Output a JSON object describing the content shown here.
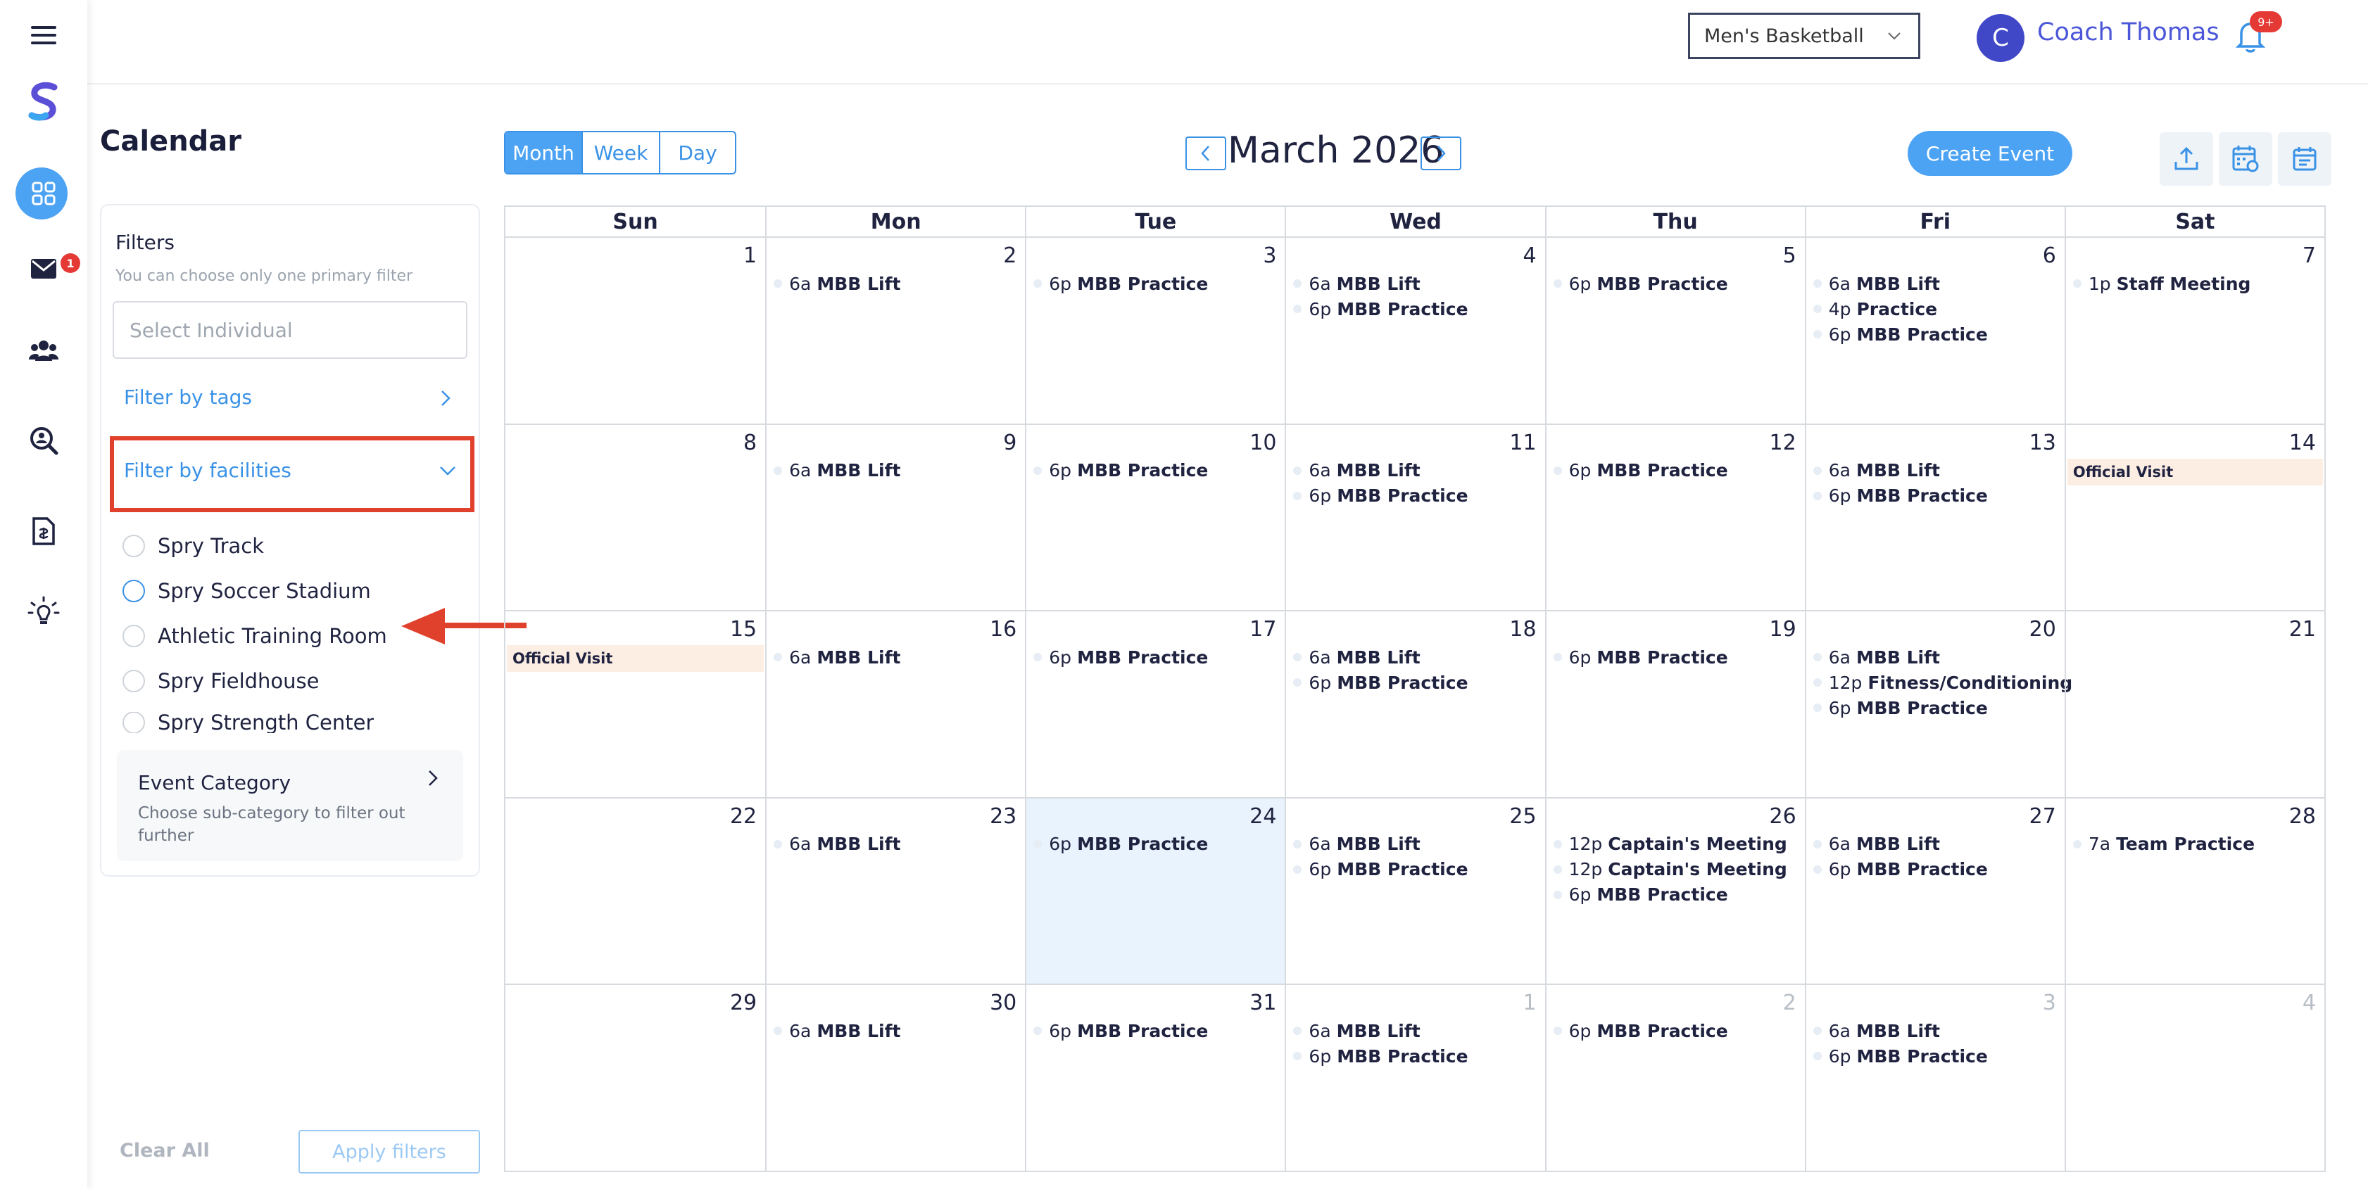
{
  "page_title": "Calendar",
  "header": {
    "team_select": "Men's Basketball",
    "avatar_initial": "C",
    "user_name": "Coach Thomas",
    "notifications_badge": "9+"
  },
  "rail": {
    "mail_badge": "1",
    "icons": [
      "menu-icon",
      "logo-icon",
      "dashboard-icon",
      "mail-icon",
      "team-icon",
      "search-analytics-icon",
      "document-icon",
      "lightbulb-icon"
    ]
  },
  "filters": {
    "title": "Filters",
    "hint": "You can choose only one primary filter",
    "select_placeholder": "Select Individual",
    "by_tags": "Filter by tags",
    "by_facilities": "Filter by facilities",
    "facilities": [
      {
        "label": "Spry Track",
        "selected": false
      },
      {
        "label": "Spry Soccer Stadium",
        "selected": true
      },
      {
        "label": "Athletic Training Room",
        "selected": false
      },
      {
        "label": "Spry Fieldhouse",
        "selected": false
      },
      {
        "label": "Spry Strength Center",
        "selected": false
      }
    ],
    "category_title": "Event Category",
    "category_desc": "Choose sub-category to filter out further",
    "clear_all": "Clear All",
    "apply": "Apply filters"
  },
  "calendar": {
    "views": [
      "Month",
      "Week",
      "Day"
    ],
    "active_view": "Month",
    "month_label": "March 2026",
    "create_event": "Create Event",
    "weekdays": [
      "Sun",
      "Mon",
      "Tue",
      "Wed",
      "Thu",
      "Fri",
      "Sat"
    ],
    "today_index": 23,
    "days": [
      {
        "d": "1",
        "events": []
      },
      {
        "d": "2",
        "events": [
          {
            "t": "6a",
            "n": "MBB Lift"
          }
        ]
      },
      {
        "d": "3",
        "events": [
          {
            "t": "6p",
            "n": "MBB Practice"
          }
        ]
      },
      {
        "d": "4",
        "events": [
          {
            "t": "6a",
            "n": "MBB Lift"
          },
          {
            "t": "6p",
            "n": "MBB Practice"
          }
        ]
      },
      {
        "d": "5",
        "events": [
          {
            "t": "6p",
            "n": "MBB Practice"
          }
        ]
      },
      {
        "d": "6",
        "events": [
          {
            "t": "6a",
            "n": "MBB Lift"
          },
          {
            "t": "4p",
            "n": "Practice"
          },
          {
            "t": "6p",
            "n": "MBB Practice"
          }
        ]
      },
      {
        "d": "7",
        "events": [
          {
            "t": "1p",
            "n": "Staff Meeting"
          }
        ]
      },
      {
        "d": "8",
        "events": []
      },
      {
        "d": "9",
        "events": [
          {
            "t": "6a",
            "n": "MBB Lift"
          }
        ]
      },
      {
        "d": "10",
        "events": [
          {
            "t": "6p",
            "n": "MBB Practice"
          }
        ]
      },
      {
        "d": "11",
        "events": [
          {
            "t": "6a",
            "n": "MBB Lift"
          },
          {
            "t": "6p",
            "n": "MBB Practice"
          }
        ]
      },
      {
        "d": "12",
        "events": [
          {
            "t": "6p",
            "n": "MBB Practice"
          }
        ]
      },
      {
        "d": "13",
        "events": [
          {
            "t": "6a",
            "n": "MBB Lift"
          },
          {
            "t": "6p",
            "n": "MBB Practice"
          }
        ]
      },
      {
        "d": "14",
        "allday": "Official Visit",
        "events": []
      },
      {
        "d": "15",
        "allday": "Official Visit",
        "events": []
      },
      {
        "d": "16",
        "events": [
          {
            "t": "6a",
            "n": "MBB Lift"
          }
        ]
      },
      {
        "d": "17",
        "events": [
          {
            "t": "6p",
            "n": "MBB Practice"
          }
        ]
      },
      {
        "d": "18",
        "events": [
          {
            "t": "6a",
            "n": "MBB Lift"
          },
          {
            "t": "6p",
            "n": "MBB Practice"
          }
        ]
      },
      {
        "d": "19",
        "events": [
          {
            "t": "6p",
            "n": "MBB Practice"
          }
        ]
      },
      {
        "d": "20",
        "events": [
          {
            "t": "6a",
            "n": "MBB Lift"
          },
          {
            "t": "12p",
            "n": "Fitness/Conditioning"
          },
          {
            "t": "6p",
            "n": "MBB Practice"
          }
        ]
      },
      {
        "d": "21",
        "events": []
      },
      {
        "d": "22",
        "events": []
      },
      {
        "d": "23",
        "events": [
          {
            "t": "6a",
            "n": "MBB Lift"
          }
        ]
      },
      {
        "d": "24",
        "events": [
          {
            "t": "6p",
            "n": "MBB Practice"
          }
        ]
      },
      {
        "d": "25",
        "events": [
          {
            "t": "6a",
            "n": "MBB Lift"
          },
          {
            "t": "6p",
            "n": "MBB Practice"
          }
        ]
      },
      {
        "d": "26",
        "events": [
          {
            "t": "12p",
            "n": "Captain's Meeting"
          },
          {
            "t": "12p",
            "n": "Captain's Meeting"
          },
          {
            "t": "6p",
            "n": "MBB Practice"
          }
        ]
      },
      {
        "d": "27",
        "events": [
          {
            "t": "6a",
            "n": "MBB Lift"
          },
          {
            "t": "6p",
            "n": "MBB Practice"
          }
        ]
      },
      {
        "d": "28",
        "events": [
          {
            "t": "7a",
            "n": "Team Practice"
          }
        ]
      },
      {
        "d": "29",
        "events": []
      },
      {
        "d": "30",
        "events": [
          {
            "t": "6a",
            "n": "MBB Lift"
          }
        ]
      },
      {
        "d": "31",
        "events": [
          {
            "t": "6p",
            "n": "MBB Practice"
          }
        ]
      },
      {
        "d": "1",
        "other": true,
        "events": [
          {
            "t": "6a",
            "n": "MBB Lift"
          },
          {
            "t": "6p",
            "n": "MBB Practice"
          }
        ]
      },
      {
        "d": "2",
        "other": true,
        "events": [
          {
            "t": "6p",
            "n": "MBB Practice"
          }
        ]
      },
      {
        "d": "3",
        "other": true,
        "events": [
          {
            "t": "6a",
            "n": "MBB Lift"
          },
          {
            "t": "6p",
            "n": "MBB Practice"
          }
        ]
      },
      {
        "d": "4",
        "other": true,
        "events": []
      }
    ]
  },
  "colors": {
    "accent": "#4da3f3",
    "highlight": "#e0412c",
    "allday_bg": "#fdeee4",
    "today_bg": "#e8f3fd"
  }
}
